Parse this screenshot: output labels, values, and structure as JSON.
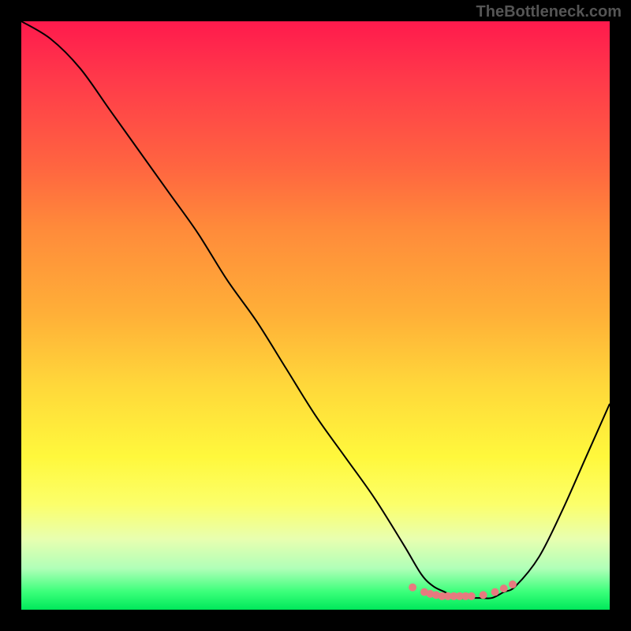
{
  "watermark": "TheBottleneck.com",
  "chart_data": {
    "type": "line",
    "title": "",
    "xlabel": "",
    "ylabel": "",
    "xlim": [
      0,
      100
    ],
    "ylim": [
      0,
      100
    ],
    "series": [
      {
        "name": "curve",
        "x": [
          0,
          5,
          10,
          15,
          20,
          25,
          30,
          35,
          40,
          45,
          50,
          55,
          60,
          65,
          68,
          70,
          72,
          74,
          76,
          78,
          80,
          82,
          84,
          88,
          92,
          96,
          100
        ],
        "y": [
          100,
          97,
          92,
          85,
          78,
          71,
          64,
          56,
          49,
          41,
          33,
          26,
          19,
          11,
          6,
          4,
          3,
          2,
          2,
          2,
          2,
          3,
          4,
          9,
          17,
          26,
          35
        ]
      }
    ],
    "markers": {
      "name": "bottom-dots",
      "x": [
        66.5,
        68.5,
        69.5,
        70.5,
        71.5,
        72.5,
        73.5,
        74.5,
        75.5,
        76.5,
        78.5,
        80.5,
        82.0,
        83.5
      ],
      "y": [
        3.8,
        3.0,
        2.7,
        2.5,
        2.3,
        2.3,
        2.3,
        2.3,
        2.3,
        2.3,
        2.5,
        3.0,
        3.6,
        4.3
      ]
    },
    "style": {
      "line_color": "#000000",
      "line_width": 2,
      "marker_color": "#e77a7f",
      "marker_radius": 5,
      "background_gradient": [
        "#ff1a4d",
        "#ff6640",
        "#ffd83a",
        "#fcff6a",
        "#00e85a"
      ]
    }
  }
}
